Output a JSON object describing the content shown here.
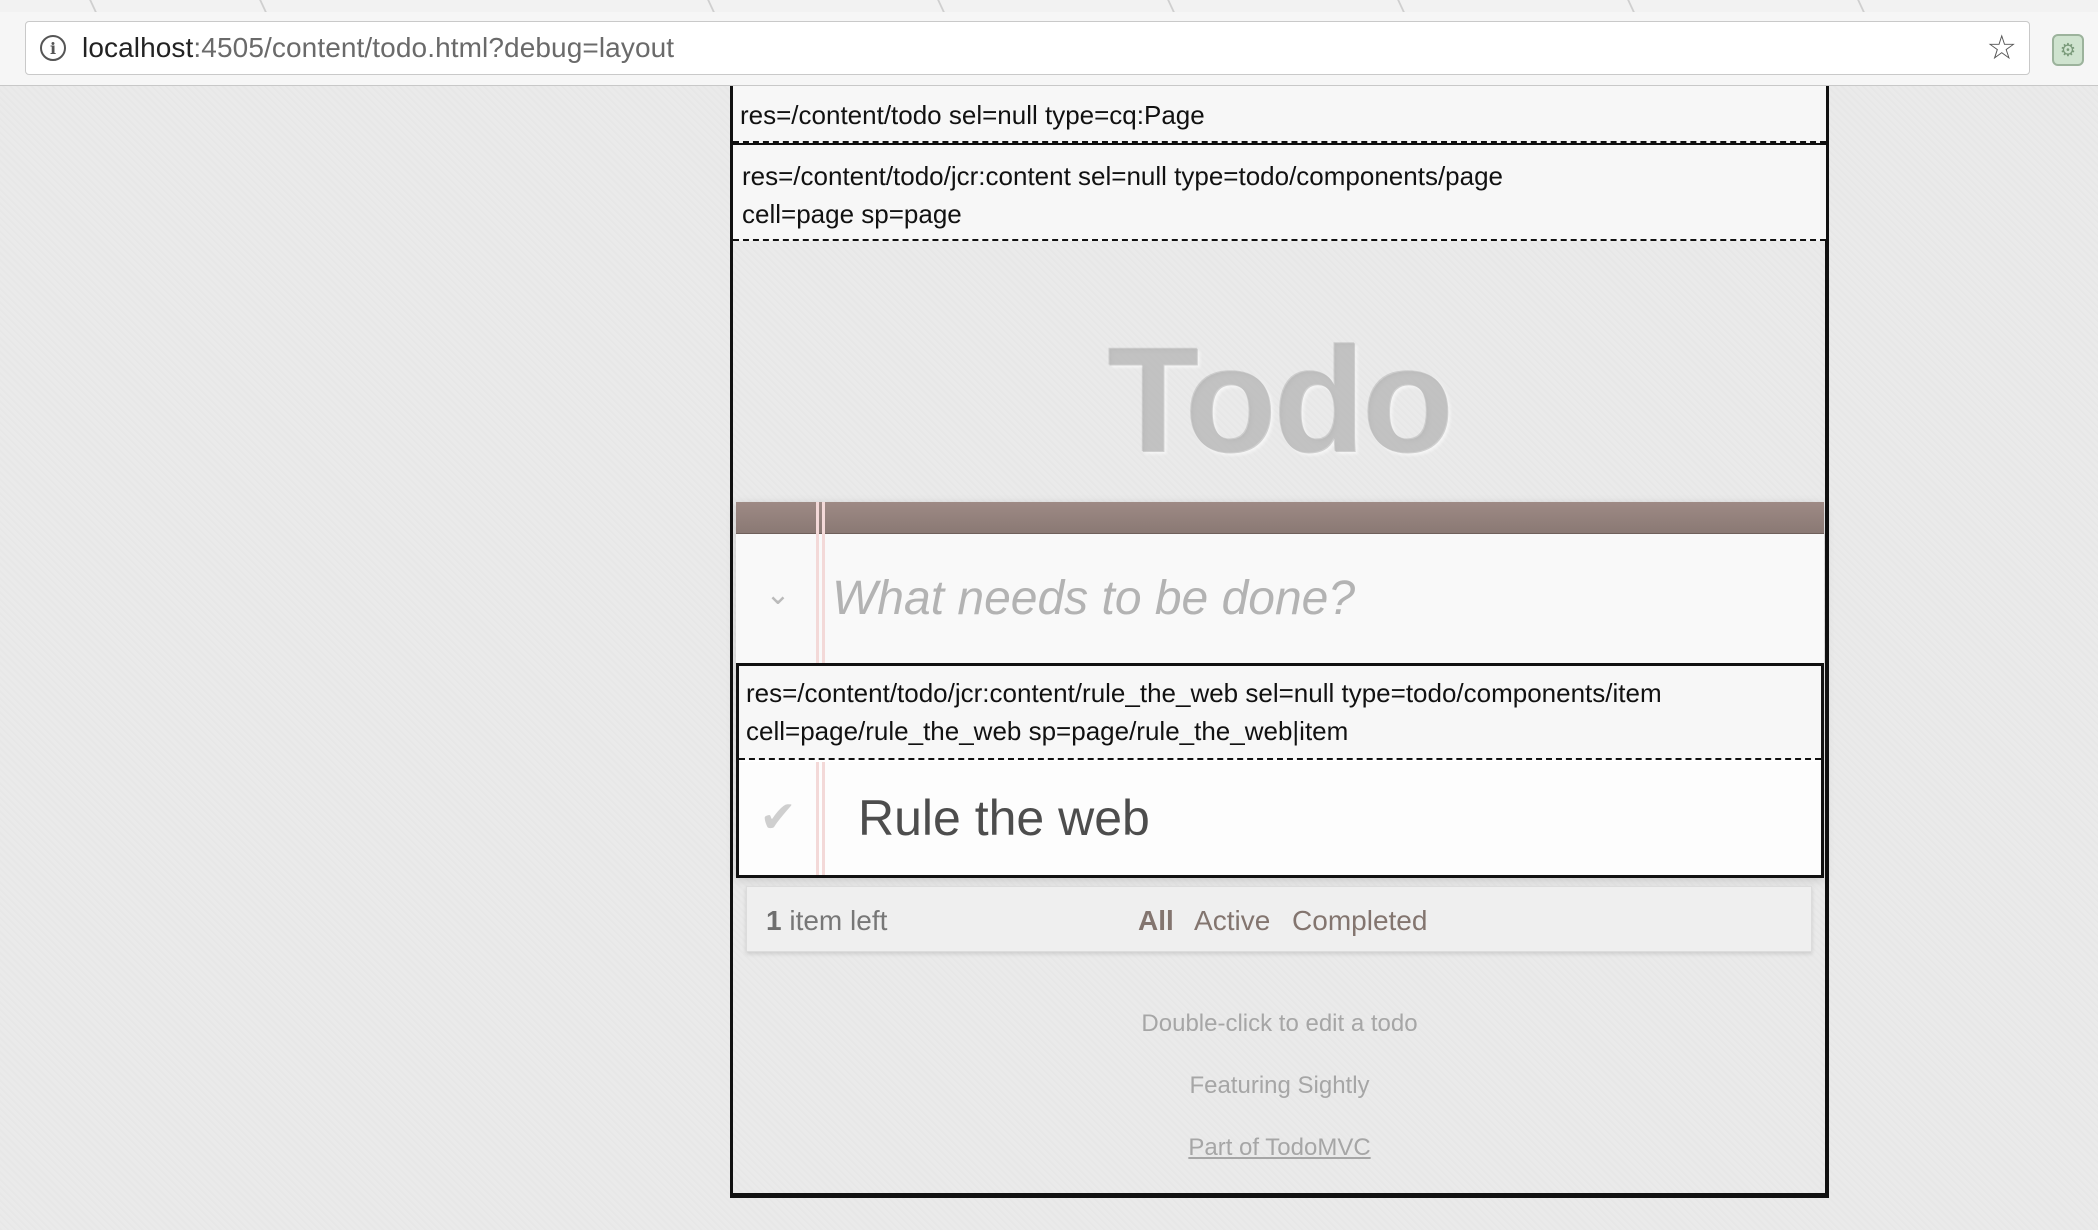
{
  "browser": {
    "url_host": "localhost",
    "url_rest": ":4505/content/todo.html?debug=layout",
    "star_icon": "bookmark-star-icon",
    "info_icon": "info-icon",
    "extension_icon": "extension-icon"
  },
  "debug": {
    "outer_label": "res=/content/todo sel=null type=cq:Page",
    "inner_label_line1": "res=/content/todo/jcr:content sel=null type=todo/components/page",
    "inner_label_line2": "cell=page sp=page",
    "item_label_line1": "res=/content/todo/jcr:content/rule_the_web sel=null type=todo/components/item",
    "item_label_line2": "cell=page/rule_the_web sp=page/rule_the_web|item"
  },
  "app": {
    "title": "Todo",
    "new_todo_placeholder": "What needs to be done?",
    "items": [
      {
        "label": "Rule the web",
        "completed": false
      }
    ],
    "footer": {
      "count_number": "1",
      "count_text": " item left",
      "filters": [
        "All",
        "Active",
        "Completed"
      ],
      "selected_filter": "All"
    },
    "info": {
      "line1": "Double-click to edit a todo",
      "line2": "Featuring Sightly",
      "line3": "Part of TodoMVC"
    }
  }
}
